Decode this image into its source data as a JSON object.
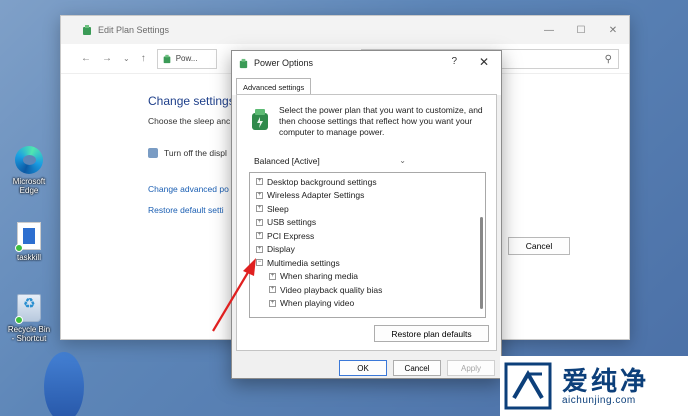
{
  "desktop": {
    "icons": [
      {
        "label": "Microsoft Edge"
      },
      {
        "label": "taskkill"
      },
      {
        "label": "Recycle Bin - Shortcut"
      }
    ]
  },
  "explorer": {
    "title": "Edit Plan Settings",
    "address_text": "Pow...",
    "heading": "Change settings",
    "subtext": "Choose the sleep anc",
    "turn_off_text": "Turn off the displ",
    "link_advanced": "Change advanced po",
    "link_restore": "Restore default setti",
    "cancel_label": "Cancel"
  },
  "dialog": {
    "title": "Power Options",
    "help_symbol": "?",
    "close_symbol": "✕",
    "tab_label": "Advanced settings",
    "intro_text": "Select the power plan that you want to customize, and then choose settings that reflect how you want your computer to manage power.",
    "plan_selected": "Balanced [Active]",
    "tree": [
      {
        "label": "Desktop background settings",
        "level": 0,
        "state": "+"
      },
      {
        "label": "Wireless Adapter Settings",
        "level": 0,
        "state": "+"
      },
      {
        "label": "Sleep",
        "level": 0,
        "state": "+"
      },
      {
        "label": "USB settings",
        "level": 0,
        "state": "+"
      },
      {
        "label": "PCI Express",
        "level": 0,
        "state": "+"
      },
      {
        "label": "Display",
        "level": 0,
        "state": "+"
      },
      {
        "label": "Multimedia settings",
        "level": 0,
        "state": "−"
      },
      {
        "label": "When sharing media",
        "level": 1,
        "state": "+"
      },
      {
        "label": "Video playback quality bias",
        "level": 1,
        "state": "+"
      },
      {
        "label": "When playing video",
        "level": 1,
        "state": "+"
      }
    ],
    "restore_label": "Restore plan defaults",
    "ok_label": "OK",
    "cancel_label": "Cancel",
    "apply_label": "Apply"
  },
  "watermark": {
    "cn_text": "爱纯净",
    "url": "aichunjing.com"
  },
  "colors": {
    "link": "#1b5fb3",
    "heading": "#1e3f8a",
    "arrow": "#e02020",
    "watermark": "#0c3f7a"
  }
}
